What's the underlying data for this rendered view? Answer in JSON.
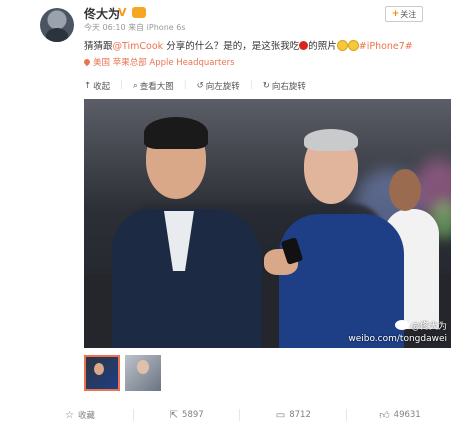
{
  "post": {
    "username": "佟大为",
    "verified_badge": "V",
    "meta": "今天 06:10 来自 iPhone 6s",
    "follow_label": "关注",
    "text_prefix": "猜猜跟",
    "mention": "@TimCook",
    "text_mid": " 分享的什么？是的，是这张我吃",
    "text_suffix": "的照片",
    "hashtag": "#iPhone7#",
    "location": "美国 苹果总部 Apple Headquarters"
  },
  "image_toolbar": {
    "collapse": "收起",
    "view_large": "查看大图",
    "rotate_left": "向左旋转",
    "rotate_right": "向右旋转"
  },
  "watermark": {
    "handle": "@佟大为",
    "url": "weibo.com/tongdawei"
  },
  "footer": {
    "favorite": "收藏",
    "repost_count": "5897",
    "comment_count": "8712",
    "like_count": "49631"
  },
  "colors": {
    "accent": "#eb7350",
    "follow_plus": "#ff8200",
    "verified": "#f29b21"
  }
}
